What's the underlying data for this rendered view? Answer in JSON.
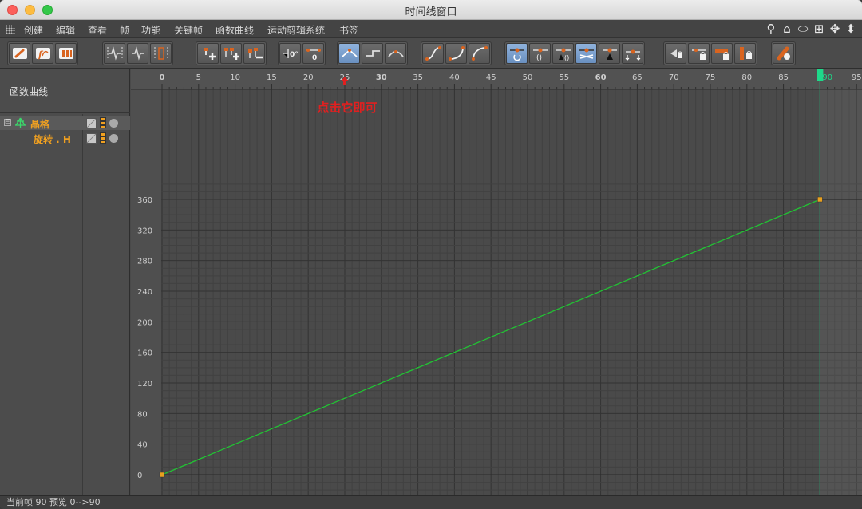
{
  "window": {
    "title": "时间线窗口"
  },
  "menu": {
    "items": [
      "创建",
      "编辑",
      "查看",
      "帧",
      "功能",
      "关键帧",
      "函数曲线",
      "运动剪辑系统",
      "书签"
    ],
    "right_icons": [
      "search-icon",
      "home-icon",
      "oval-icon",
      "frame-all-icon",
      "move-icon",
      "scroll-icon"
    ]
  },
  "left_panel": {
    "title": "函数曲线",
    "tree": [
      {
        "label": "晶格",
        "expander": "⊟",
        "icon": "lattice-icon"
      },
      {
        "label": "旋转 . H"
      }
    ]
  },
  "graph": {
    "annotation": "点击它即可",
    "playhead_frame": "90",
    "x_ticks": [
      "0",
      "5",
      "10",
      "15",
      "20",
      "25",
      "30",
      "35",
      "40",
      "45",
      "50",
      "55",
      "60",
      "65",
      "70",
      "75",
      "80",
      "85",
      "90",
      "95"
    ],
    "y_ticks": [
      "0",
      "40",
      "80",
      "120",
      "160",
      "200",
      "240",
      "280",
      "320",
      "360"
    ],
    "curve_color": "#22c234",
    "playhead_color": "#1ed98a",
    "key_color": "#e8a020"
  },
  "chart_data": {
    "type": "line",
    "title": "",
    "xlabel": "",
    "ylabel": "",
    "xlim": [
      0,
      95
    ],
    "ylim": [
      0,
      360
    ],
    "series": [
      {
        "x": [
          0,
          90
        ],
        "y": [
          0,
          360
        ]
      }
    ]
  },
  "status": {
    "current_frame_label": "当前帧",
    "current_frame": "90",
    "preview_label": "预览",
    "preview_range": "0-->90"
  }
}
